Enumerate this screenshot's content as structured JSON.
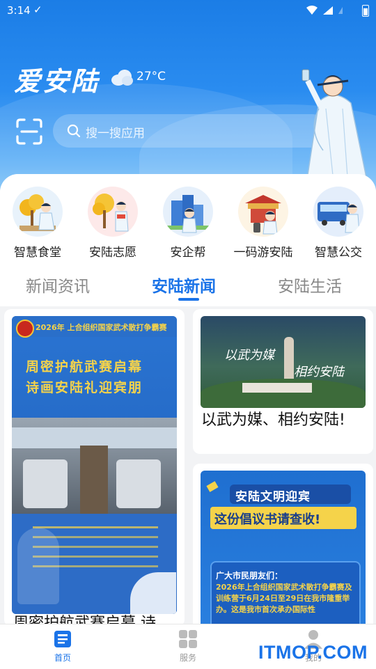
{
  "status_bar": {
    "time": "3:14"
  },
  "header": {
    "logo_text": "爱安陆",
    "weather_temp": "27°C",
    "weather_icon": "cloud-icon",
    "search_placeholder": "搜一搜应用"
  },
  "services": [
    {
      "label": "智慧食堂",
      "icon": "canteen-icon"
    },
    {
      "label": "安陆志愿",
      "icon": "volunteer-icon"
    },
    {
      "label": "安企帮",
      "icon": "enterprise-icon"
    },
    {
      "label": "一码游安陆",
      "icon": "tourism-icon"
    },
    {
      "label": "智慧公交",
      "icon": "bus-icon"
    }
  ],
  "tabs": [
    {
      "label": "新闻资讯",
      "active": false
    },
    {
      "label": "安陆新闻",
      "active": true
    },
    {
      "label": "安陆生活",
      "active": false
    }
  ],
  "cards": {
    "left": {
      "poster_header": "2026年 上合组织国家武术散打争霸赛",
      "poster_line1": "周密护航武赛启幕",
      "poster_line2": "诗画安陆礼迎宾朋",
      "title": "周密护航武赛启幕 诗"
    },
    "right_top": {
      "poster_line1": "以武为媒",
      "poster_line2": "相约安陆",
      "title": "以武为媒、相约安陆!"
    },
    "right_bottom": {
      "poster_line1": "安陆文明迎宾",
      "poster_line2": "这份倡议书请查收!",
      "body_greeting": "广大市民朋友们：",
      "body_text": "2026年上合组织国家武术散打争霸赛及训练营于6月24日至29日在我市隆重举办。这是我市首次承办国际性"
    }
  },
  "bottom_nav": [
    {
      "label": "首页",
      "icon": "news-icon",
      "active": true
    },
    {
      "label": "服务",
      "icon": "grid-icon",
      "active": false
    },
    {
      "label": "我的",
      "icon": "user-icon",
      "active": false
    }
  ],
  "watermark": "ITMOP.COM",
  "colors": {
    "accent": "#1a73e8",
    "hero_top": "#1b7de6",
    "poster_blue": "#1f6fd0"
  }
}
